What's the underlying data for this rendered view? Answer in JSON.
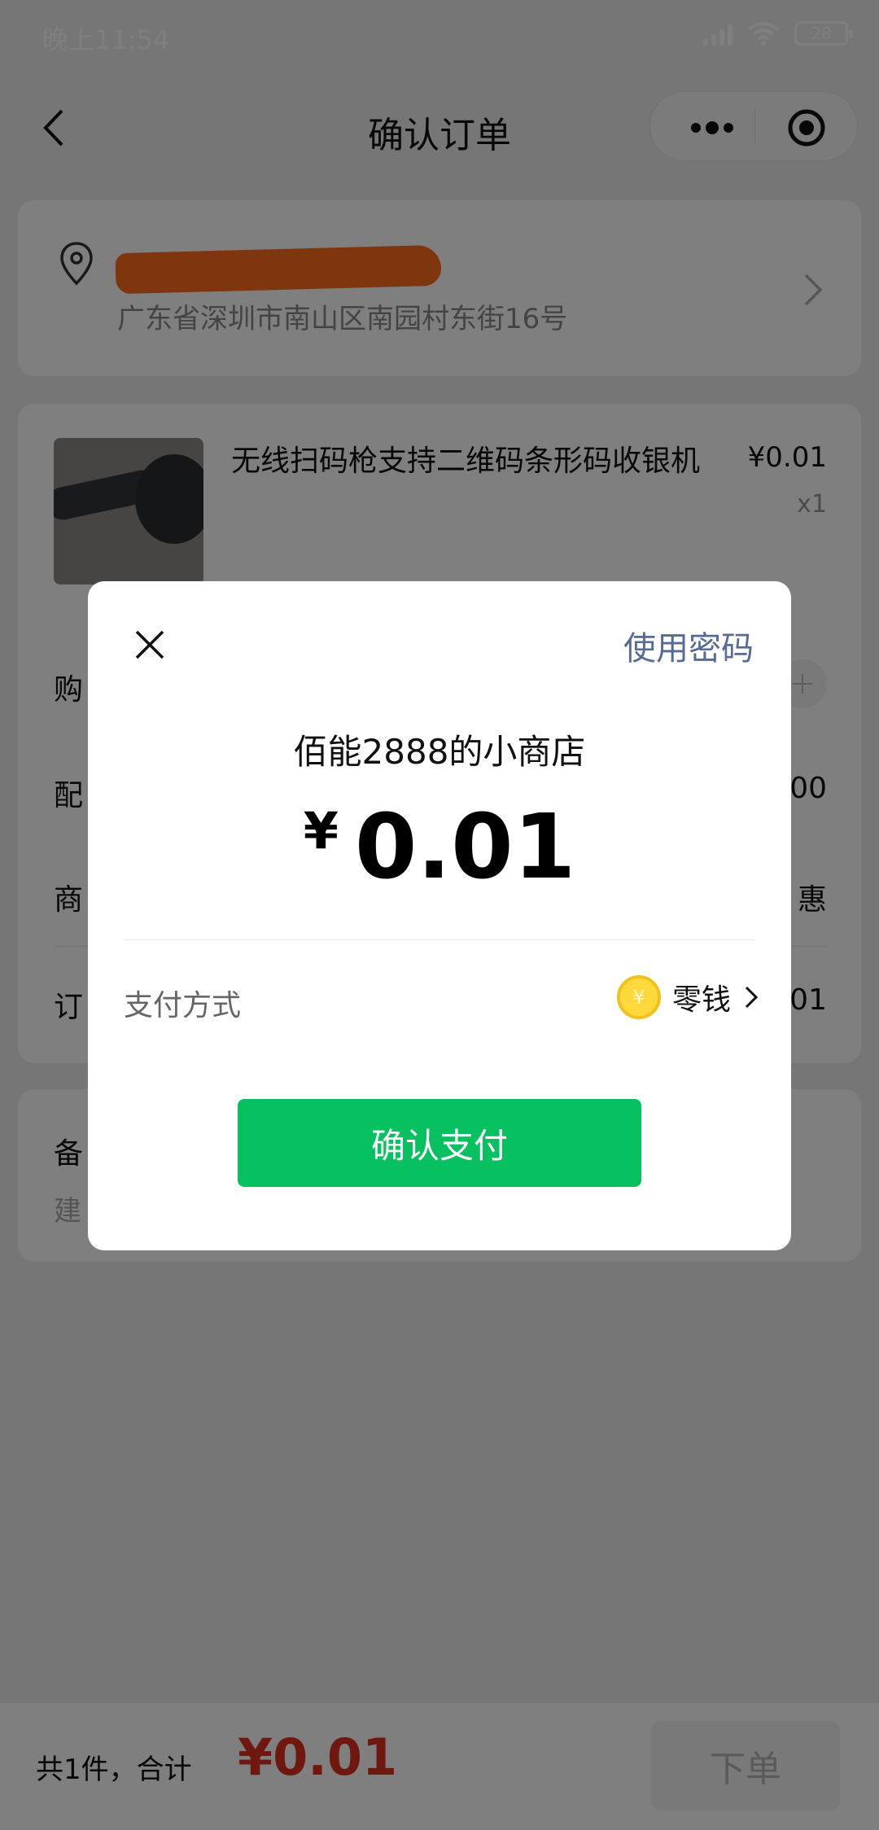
{
  "status_bar": {
    "time": "晚上11:54",
    "battery": "28"
  },
  "nav": {
    "title": "确认订单"
  },
  "address": {
    "name": "+",
    "detail": "广东省深圳市南山区南园村东街16号"
  },
  "product": {
    "title": "无线扫码枪支持二维码条形码收银机",
    "price": "¥0.01",
    "quantity": "x1"
  },
  "order_rows": [
    {
      "label": "购",
      "value": ""
    },
    {
      "label": "配",
      "value": "00"
    },
    {
      "label": "商",
      "value": "惠"
    },
    {
      "label": "订",
      "value": ".01"
    }
  ],
  "remark": {
    "label": "备",
    "placeholder": "建"
  },
  "bottom": {
    "summary": "共1件，合计",
    "total": "¥0.01",
    "submit_label": "下单"
  },
  "pay_dialog": {
    "use_password": "使用密码",
    "shop_name": "佰能2888的小商店",
    "currency_symbol": "¥",
    "amount": "0.01",
    "method_label": "支付方式",
    "method_value": "零钱",
    "coin_symbol": "¥",
    "confirm_label": "确认支付"
  },
  "colors": {
    "wechat_green": "#07c160",
    "price_red": "#e0311f",
    "link_blue": "#576b95",
    "redaction_orange": "#ff6a1a"
  },
  "icons": [
    "back-icon",
    "more-icon",
    "target-icon",
    "location-icon",
    "chevron-right-icon",
    "plus-icon",
    "close-icon",
    "coin-icon",
    "chevron-right-icon"
  ]
}
